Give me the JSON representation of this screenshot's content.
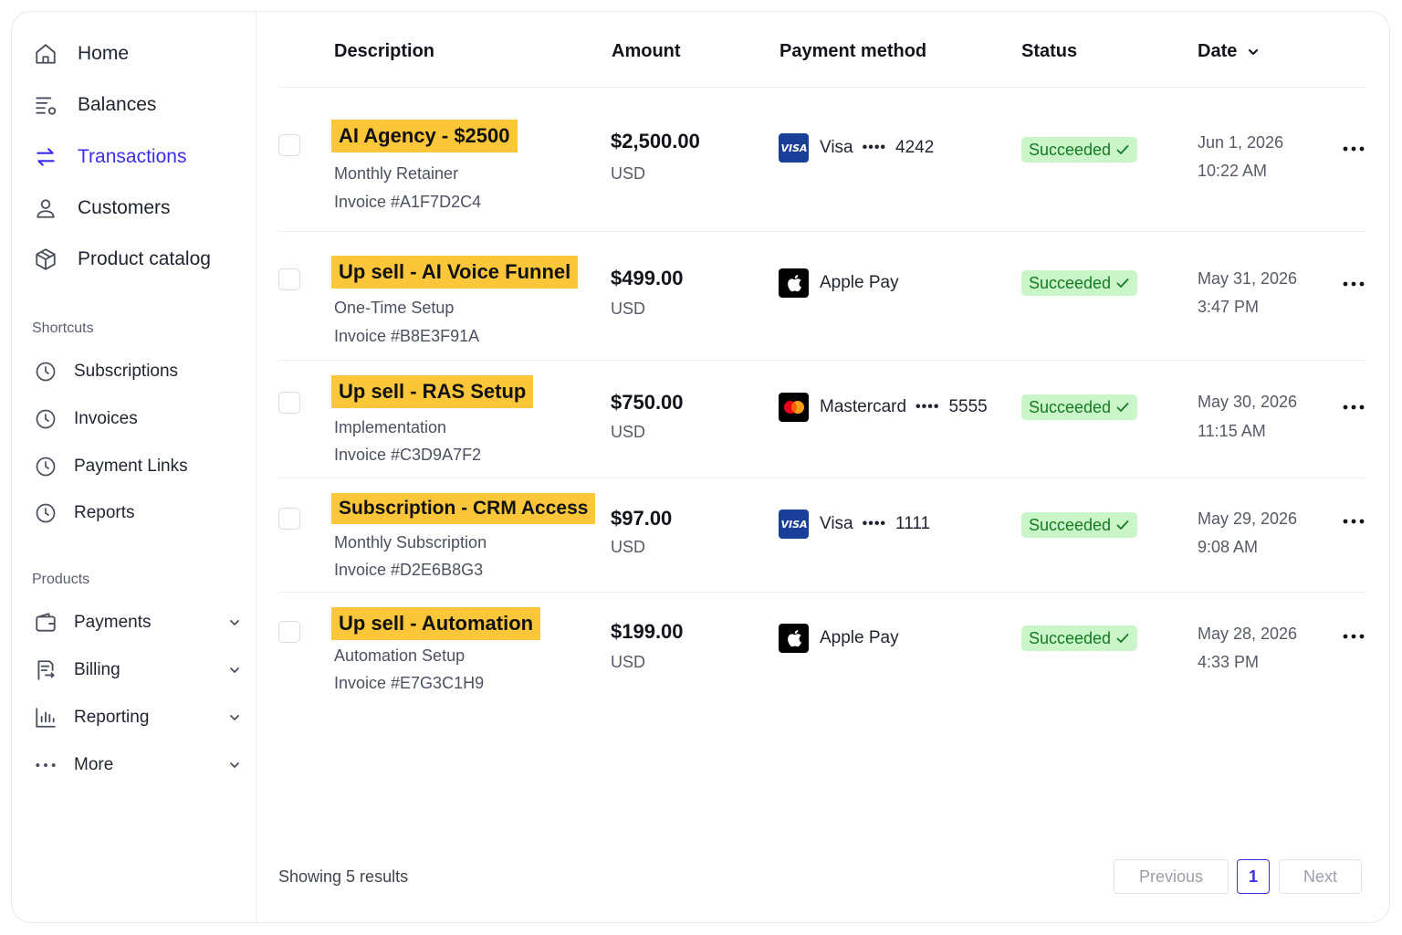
{
  "sidebar": {
    "main_nav": [
      {
        "label": "Home",
        "icon": "home-icon"
      },
      {
        "label": "Balances",
        "icon": "balances-icon"
      },
      {
        "label": "Transactions",
        "icon": "transactions-icon",
        "active": true
      },
      {
        "label": "Customers",
        "icon": "user-icon"
      },
      {
        "label": "Product catalog",
        "icon": "package-icon"
      }
    ],
    "shortcuts_title": "Shortcuts",
    "shortcuts": [
      {
        "label": "Subscriptions",
        "icon": "clock-icon"
      },
      {
        "label": "Invoices",
        "icon": "clock-icon"
      },
      {
        "label": "Payment Links",
        "icon": "clock-icon"
      },
      {
        "label": "Reports",
        "icon": "clock-icon"
      }
    ],
    "products_title": "Products",
    "products": [
      {
        "label": "Payments",
        "icon": "wallet-icon"
      },
      {
        "label": "Billing",
        "icon": "billing-icon"
      },
      {
        "label": "Reporting",
        "icon": "bar-chart-icon"
      },
      {
        "label": "More",
        "icon": "more-horizontal-icon"
      }
    ]
  },
  "table": {
    "headers": {
      "description": "Description",
      "amount": "Amount",
      "payment_method": "Payment method",
      "status": "Status",
      "date": "Date"
    },
    "rows": [
      {
        "title": "AI Agency - $2500",
        "subtitle": "Monthly Retainer",
        "invoice": "Invoice #A1F7D2C4",
        "amount": "$2,500.00",
        "currency": "USD",
        "method": "Visa",
        "method_type": "visa",
        "dots": "••••",
        "last4": "4242",
        "status": "Succeeded",
        "date": "Jun 1, 2026",
        "time": "10:22 AM"
      },
      {
        "title": "Up sell - AI Voice Funnel",
        "subtitle": "One-Time Setup",
        "invoice": "Invoice #B8E3F91A",
        "amount": "$499.00",
        "currency": "USD",
        "method": "Apple Pay",
        "method_type": "apple",
        "dots": "",
        "last4": "",
        "status": "Succeeded",
        "date": "May 31, 2026",
        "time": "3:47 PM"
      },
      {
        "title": "Up sell - RAS Setup",
        "subtitle": "Implementation",
        "invoice": "Invoice #C3D9A7F2",
        "amount": "$750.00",
        "currency": "USD",
        "method": "Mastercard",
        "method_type": "mastercard",
        "dots": "••••",
        "last4": "5555",
        "status": "Succeeded",
        "date": "May 30, 2026",
        "time": "11:15 AM"
      },
      {
        "title": "Subscription - CRM Access",
        "subtitle": "Monthly Subscription",
        "invoice": "Invoice #D2E6B8G3",
        "amount": "$97.00",
        "currency": "USD",
        "method": "Visa",
        "method_type": "visa",
        "dots": "••••",
        "last4": "1111",
        "status": "Succeeded",
        "date": "May 29, 2026",
        "time": "9:08 AM"
      },
      {
        "title": "Up sell - Automation",
        "subtitle": "Automation Setup",
        "invoice": "Invoice #E7G3C1H9",
        "amount": "$199.00",
        "currency": "USD",
        "method": "Apple Pay",
        "method_type": "apple",
        "dots": "",
        "last4": "",
        "status": "Succeeded",
        "date": "May 28, 2026",
        "time": "4:33 PM"
      }
    ]
  },
  "footer": {
    "results_text": "Showing 5 results",
    "previous_label": "Previous",
    "current_page": "1",
    "next_label": "Next"
  },
  "colors": {
    "accent": "#3b2ee8",
    "highlight": "#fcc63a",
    "success_bg": "#c9f5c9",
    "success_text": "#157a22",
    "visa_blue": "#1a3f9a"
  }
}
